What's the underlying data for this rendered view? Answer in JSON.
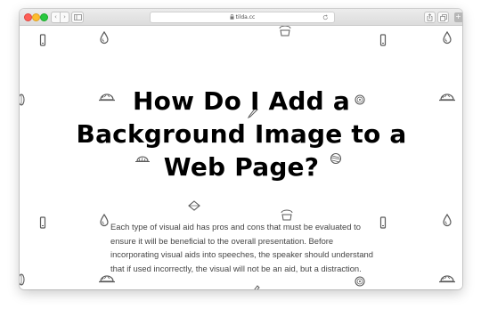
{
  "browser": {
    "url": "tilda.cc",
    "back_glyph": "‹",
    "forward_glyph": "›",
    "new_tab_glyph": "+"
  },
  "page": {
    "title": "How Do I Add a Background Image to a Web Page?",
    "body": "Each type of visual aid has pros and cons that must be evaluated to ensure it will be beneficial to the overall presentation. Before incorporating visual aids into speeches, the speaker should understand that if used incorrectly, the visual will not be an aid, but a distraction."
  },
  "colors": {
    "title": "#000000",
    "body_text": "#454545",
    "pattern": "#5a5a5a"
  },
  "icons": {
    "pattern": [
      "phone-icon",
      "drop-icon",
      "leaf-icon",
      "tomato-icon",
      "lemon-icon",
      "hat-icon",
      "melon-icon",
      "diamond-icon",
      "pencil-icon",
      "cup-icon"
    ],
    "toolbar": [
      "back-icon",
      "forward-icon",
      "sidebar-icon",
      "lock-icon",
      "reload-icon",
      "share-icon",
      "tabs-icon",
      "new-tab-icon"
    ]
  }
}
